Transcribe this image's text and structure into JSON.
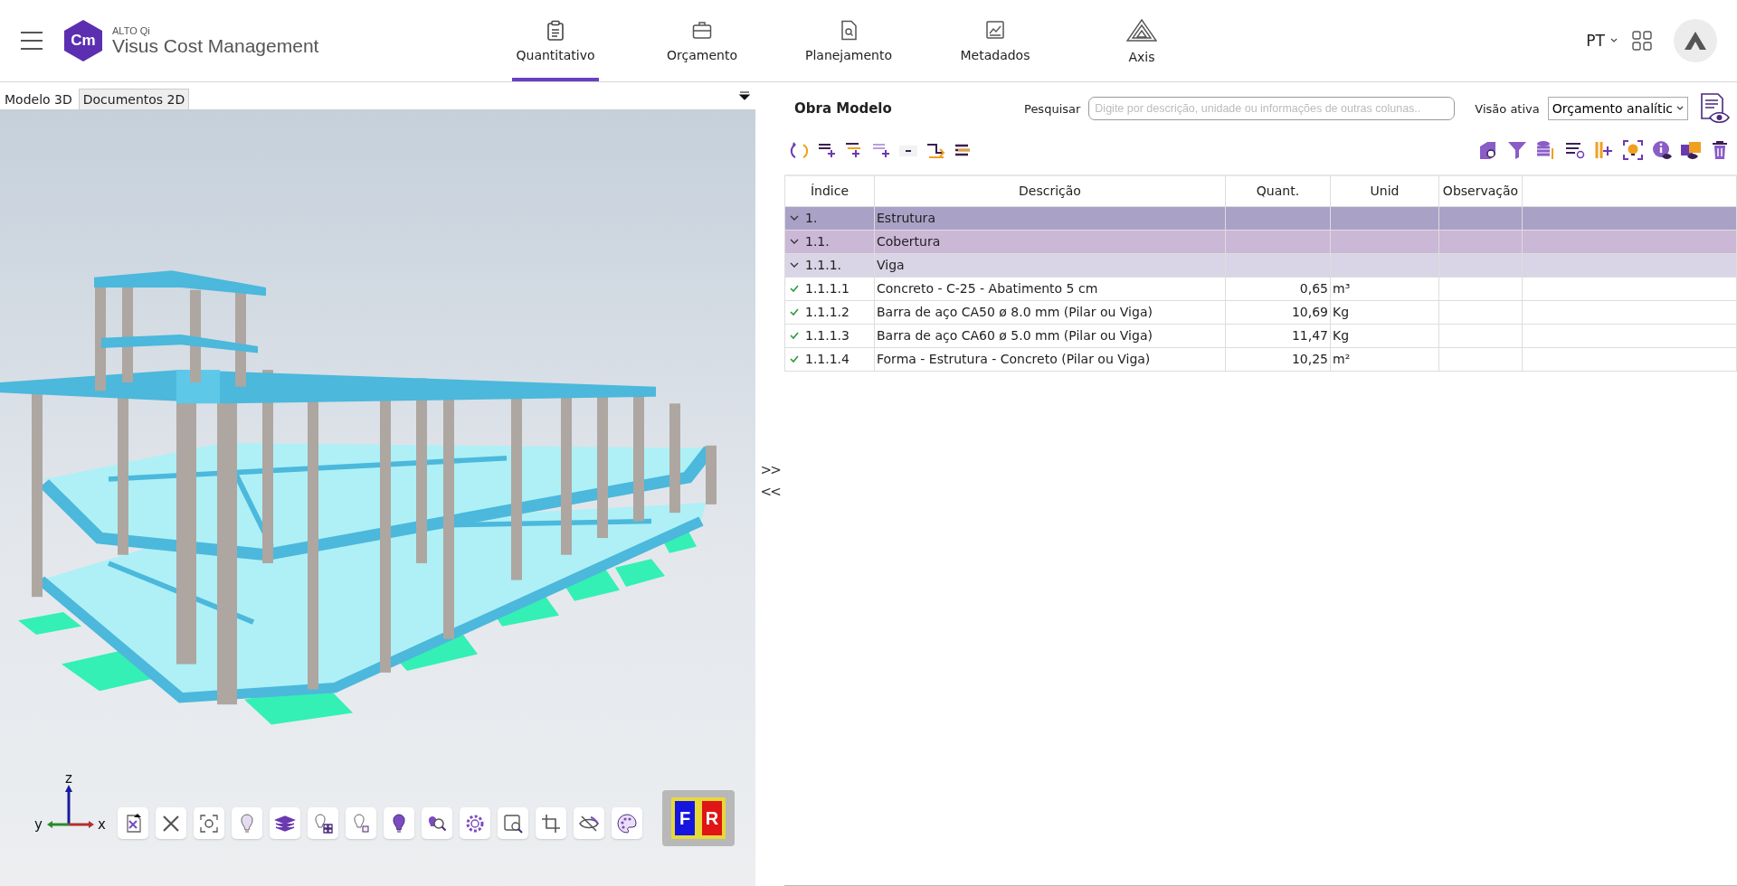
{
  "header": {
    "logo": {
      "badge": "Cm",
      "brand": "ALTO Qi",
      "product": "Visus Cost Management"
    },
    "nav": [
      {
        "label": "Quantitativo",
        "selected": true
      },
      {
        "label": "Orçamento",
        "selected": false
      },
      {
        "label": "Planejamento",
        "selected": false
      },
      {
        "label": "Metadados",
        "selected": false
      },
      {
        "label": "Axis",
        "selected": false
      }
    ],
    "language": "PT"
  },
  "viewer": {
    "tabs": [
      {
        "label": "Modelo 3D",
        "selected": true
      },
      {
        "label": "Documentos 2D",
        "selected": false
      }
    ],
    "axes": {
      "z": "z",
      "y": "y",
      "x": "x"
    },
    "view_cube": [
      "F",
      "R"
    ]
  },
  "splitter": [
    ">>",
    "<<"
  ],
  "budget": {
    "title": "Obra Modelo",
    "search": {
      "label": "Pesquisar",
      "placeholder": "Digite por descrição, unidade ou informações de outras colunas.."
    },
    "view": {
      "label": "Visão ativa",
      "value": "Orçamento analític"
    },
    "table": {
      "columns": [
        "Índice",
        "Descrição",
        "Quant.",
        "Unid",
        "Observação"
      ],
      "rows": [
        {
          "kind": "group",
          "index": "1.",
          "description": "Estrutura",
          "expanded": true,
          "children": [
            {
              "kind": "group",
              "index": "1.1.",
              "description": "Cobertura",
              "expanded": true,
              "children": [
                {
                  "kind": "group",
                  "index": "1.1.1.",
                  "description": "Viga",
                  "expanded": true,
                  "children": [
                    {
                      "kind": "item",
                      "index": "1.1.1.1",
                      "description": "Concreto - C-25 - Abatimento 5 cm",
                      "quantity": "0,65",
                      "unit": "m³",
                      "done": true
                    },
                    {
                      "kind": "item",
                      "index": "1.1.1.2",
                      "description": "Barra de aço CA50  ø 8.0 mm (Pilar ou Viga)",
                      "quantity": "10,69",
                      "unit": "Kg",
                      "done": true
                    },
                    {
                      "kind": "item",
                      "index": "1.1.1.3",
                      "description": "Barra de aço CA60  ø 5.0 mm (Pilar ou Viga)",
                      "quantity": "11,47",
                      "unit": "Kg",
                      "done": true
                    },
                    {
                      "kind": "item",
                      "index": "1.1.1.4",
                      "description": "Forma - Estrutura - Concreto (Pilar ou Viga)",
                      "quantity": "10,25",
                      "unit": "m²",
                      "done": true
                    }
                  ]
                }
              ]
            }
          ]
        }
      ]
    }
  }
}
